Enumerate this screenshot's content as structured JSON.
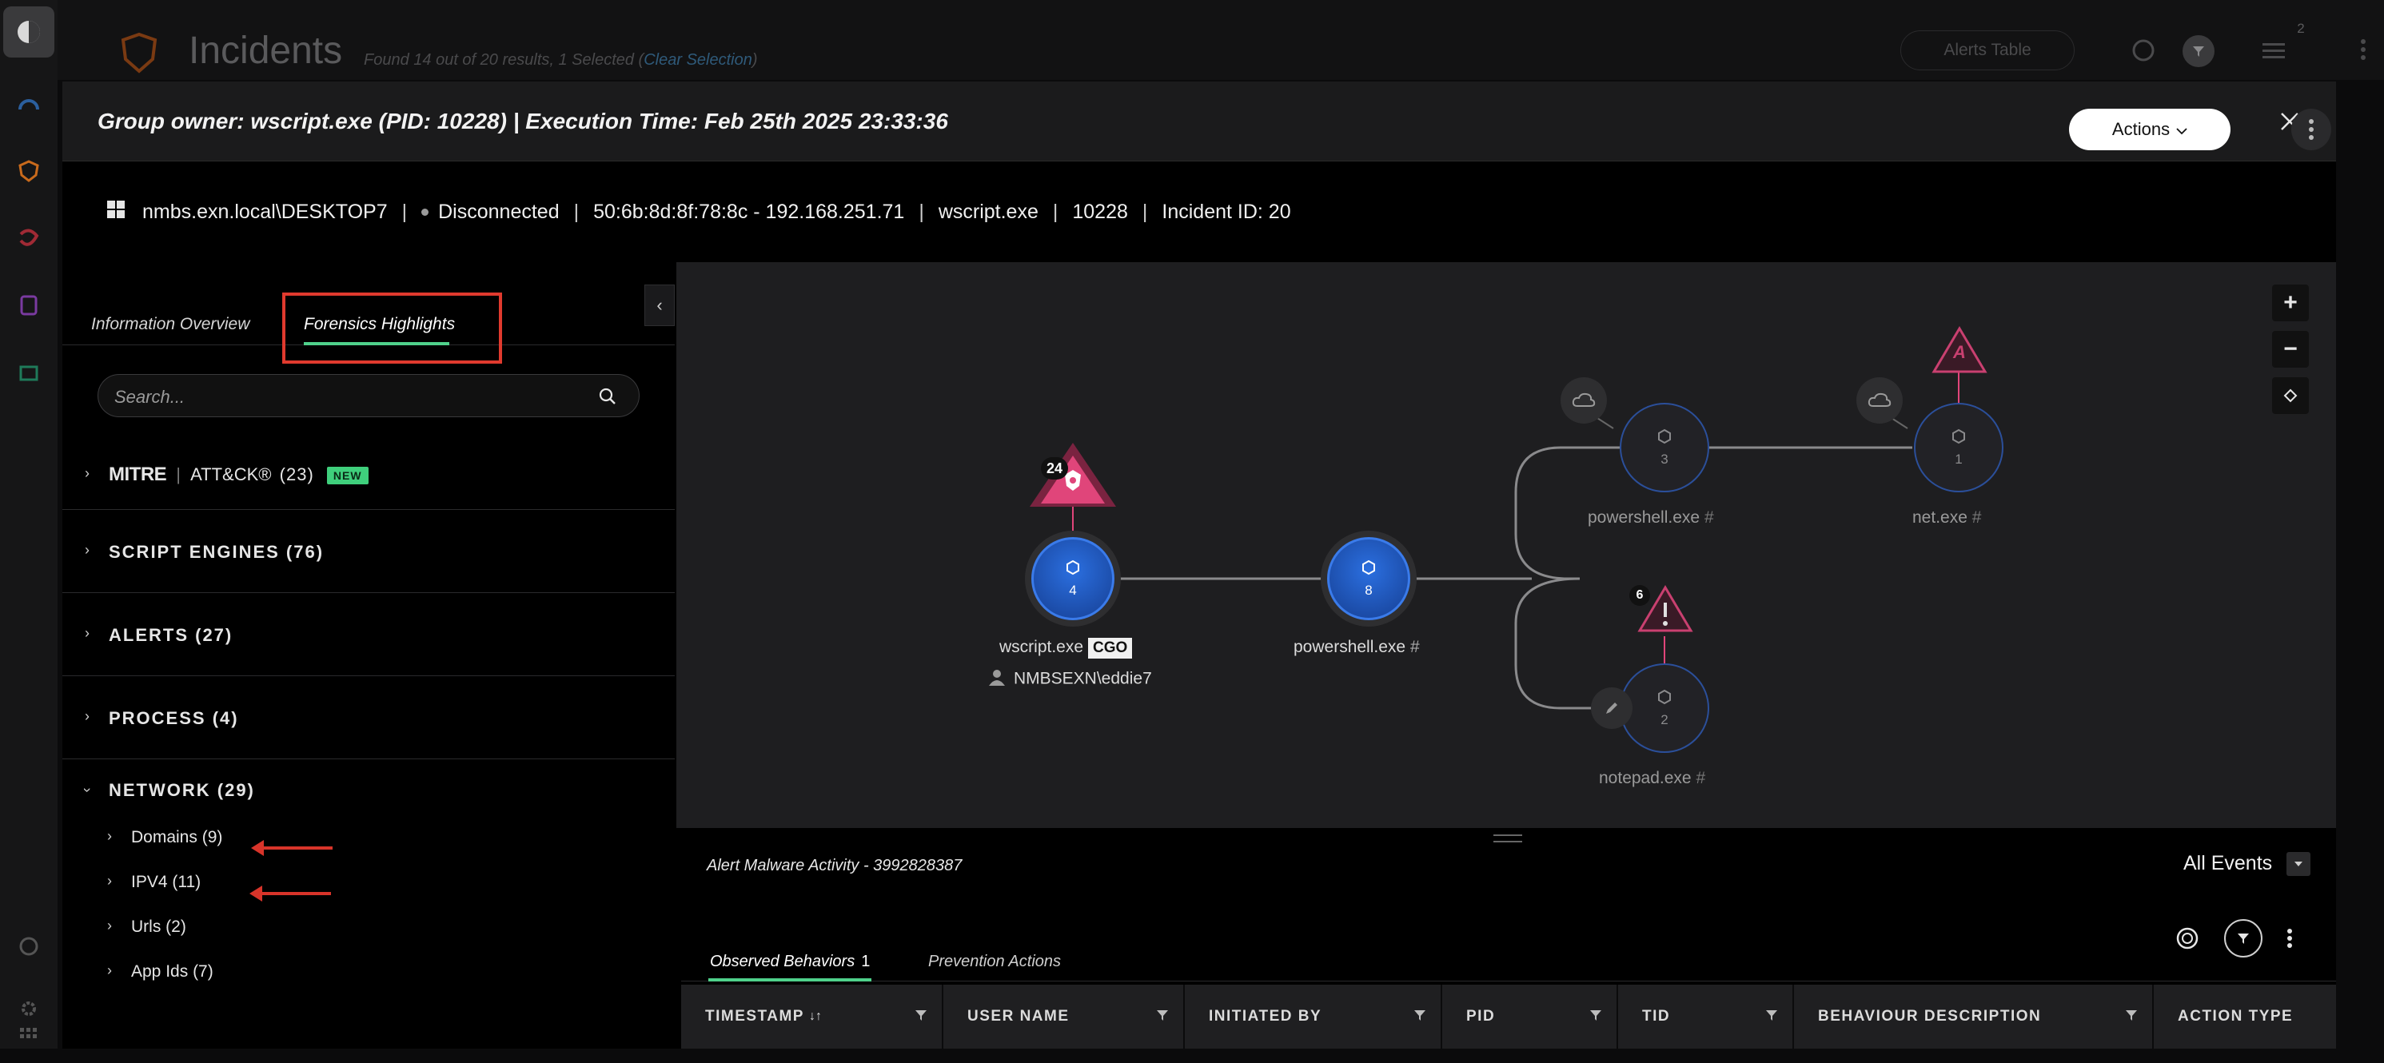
{
  "background": {
    "page_title": "Incidents",
    "results_text": "Found 14 out of 20 results, 1 Selected (",
    "clear_selection": "Clear Selection",
    "results_close": ")",
    "alerts_table_label": "Alerts Table",
    "notifications_count": "2"
  },
  "modal": {
    "title": "Group owner: wscript.exe (PID: 10228) | Execution Time: Feb 25th 2025 23:33:36",
    "close_icon": "close-icon"
  },
  "infobar": {
    "host": "nmbs.exn.local\\DESKTOP7",
    "status": "Disconnected",
    "network": "50:6b:8d:8f:78:8c - 192.168.251.71",
    "process": "wscript.exe",
    "pid": "10228",
    "incident": "Incident ID: 20",
    "separator": "|",
    "actions_label": "Actions"
  },
  "left_panel": {
    "tabs": [
      "Information Overview",
      "Forensics Highlights"
    ],
    "active_tab": "Forensics Highlights",
    "search_placeholder": "Search...",
    "sections": [
      {
        "label": "MITRE | ATT&CK® (23)",
        "mitre": "MITRE",
        "attck": "ATT&CK®",
        "count": "(23)",
        "badge": "NEW",
        "expanded": false
      },
      {
        "label": "SCRIPT ENGINES (76)",
        "expanded": false
      },
      {
        "label": "ALERTS (27)",
        "expanded": false
      },
      {
        "label": "PROCESS (4)",
        "expanded": false
      },
      {
        "label": "NETWORK (29)",
        "expanded": true
      }
    ],
    "network_children": [
      {
        "label": "Domains",
        "count": "(9)"
      },
      {
        "label": "IPV4",
        "count": "(11)"
      },
      {
        "label": "Urls",
        "count": "(2)"
      },
      {
        "label": "App Ids",
        "count": "(7)"
      }
    ]
  },
  "graph": {
    "nodes": [
      {
        "name": "wscript.exe",
        "count": "4",
        "tag": "CGO",
        "user": "NMBSEXN\\eddie7",
        "alert_count": "24"
      },
      {
        "name": "powershell.exe",
        "count": "8"
      },
      {
        "name": "powershell.exe",
        "count": "3"
      },
      {
        "name": "net.exe",
        "count": "1",
        "alert_letter": "A"
      },
      {
        "name": "notepad.exe",
        "count": "2",
        "alert_count": "6"
      }
    ],
    "zoom_in": "+",
    "zoom_out": "−"
  },
  "detail": {
    "title": "Alert Malware Activity - 3992828387",
    "events_filter": "All Events",
    "tabs": [
      {
        "label": "Observed Behaviors",
        "count": "1"
      },
      {
        "label": "Prevention Actions",
        "count": ""
      }
    ],
    "columns": [
      "TIMESTAMP",
      "USER NAME",
      "INITIATED BY",
      "PID",
      "TID",
      "BEHAVIOUR DESCRIPTION",
      "ACTION TYPE"
    ],
    "sort_indicator": "↓↑"
  },
  "colors": {
    "accent_green": "#4fd18b",
    "annotation_red": "#e03a2e",
    "node_blue": "#1f5fd1",
    "alert_pink": "#e0457a"
  }
}
